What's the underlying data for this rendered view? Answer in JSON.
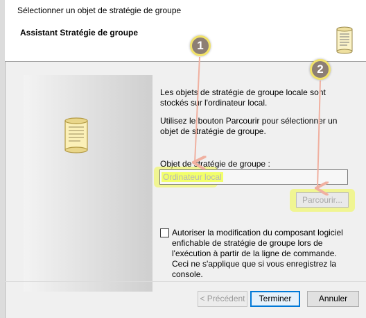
{
  "window": {
    "title": "Sélectionner un objet de stratégie de groupe"
  },
  "header": {
    "title": "Assistant Stratégie de groupe",
    "icon": "scroll-icon"
  },
  "body": {
    "description_1": "Les objets de stratégie de groupe locale sont stockés sur l'ordinateur local.",
    "description_2": "Utilisez le bouton Parcourir pour sélectionner un objet de stratégie de groupe.",
    "gpo_label": "Objet de stratégie de groupe :",
    "gpo_value": "Ordinateur local",
    "browse_label": "Parcourir...",
    "checkbox_checked": false,
    "checkbox_label": "Autoriser la modification du composant logiciel enfichable de stratégie de groupe lors de l'exécution à partir de la ligne de commande. Ceci ne s'applique que si vous enregistrez la console."
  },
  "footer": {
    "previous_label": "< Précédent",
    "finish_label": "Terminer",
    "cancel_label": "Annuler"
  },
  "annotations": [
    {
      "number": "1"
    },
    {
      "number": "2"
    }
  ],
  "colors": {
    "highlight": "#f2ff6a",
    "badge": "#8d7f74",
    "arrow": "#f0b0a0",
    "focus_border": "#0078d7"
  }
}
